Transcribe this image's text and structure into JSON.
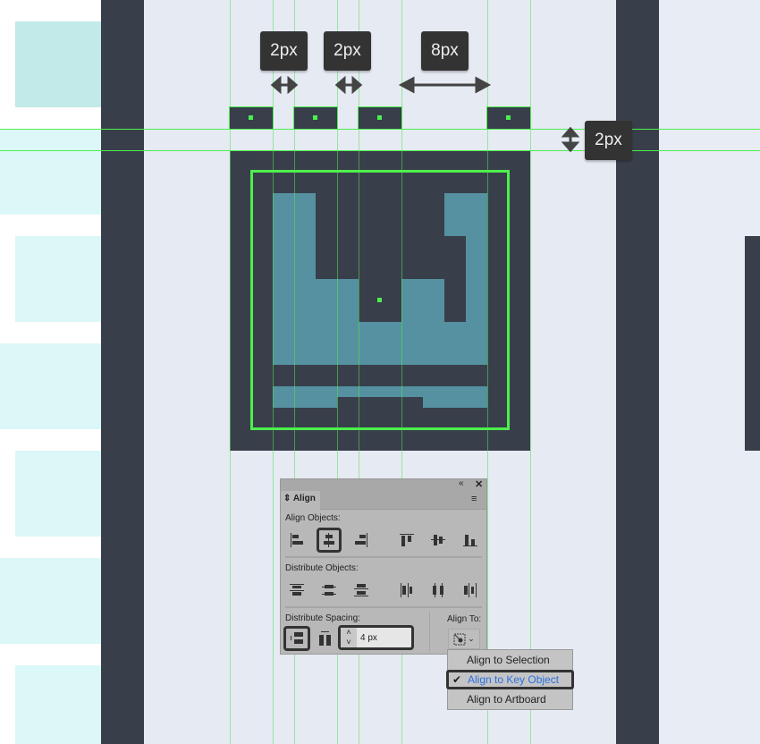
{
  "measurements": {
    "gap1": "2px",
    "gap2": "2px",
    "gap3": "8px",
    "vertical_gap": "2px"
  },
  "colors": {
    "dark": "#393e4b",
    "teal": "#5591a0",
    "guide": "#4cf04c",
    "artboard": "#e6eaf3"
  },
  "align_panel": {
    "tab": "Align",
    "align_objects_label": "Align Objects:",
    "distribute_objects_label": "Distribute Objects:",
    "distribute_spacing_label": "Distribute Spacing:",
    "align_to_label": "Align To:",
    "spacing_value": "4 px",
    "align_buttons": [
      "horizontal-align-left",
      "horizontal-align-center",
      "horizontal-align-right",
      "vertical-align-top",
      "vertical-align-center",
      "vertical-align-bottom"
    ],
    "selected_align": "horizontal-align-center"
  },
  "align_to_menu": {
    "items": [
      {
        "label": "Align to Selection",
        "checked": false
      },
      {
        "label": "Align to Key Object",
        "checked": true
      },
      {
        "label": "Align to Artboard",
        "checked": false
      }
    ]
  }
}
